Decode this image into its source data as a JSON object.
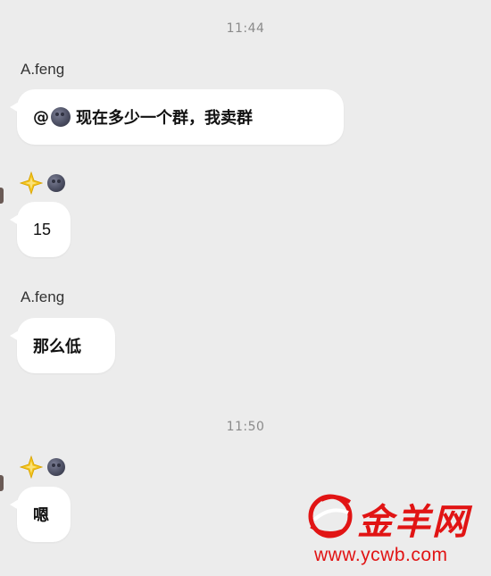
{
  "chat": {
    "time1": "11:44",
    "time2": "11:50",
    "sender_afeng": "A.feng",
    "msg1_prefix": "@",
    "msg1_text": " 现在多少一个群，我卖群",
    "msg2_text": "15",
    "msg3_text": "那么低",
    "msg4_text": "嗯"
  },
  "watermark": {
    "brand": "金羊网",
    "url": "www.ycwb.com"
  },
  "colors": {
    "background": "#ececec",
    "bubble": "#ffffff",
    "watermark_red": "#e11414",
    "sparkle_yellow": "#f2c21a"
  },
  "icons": {
    "sender_badge": "yellow-sparkle-icon",
    "sender_avatar_emoji": "new-moon-face-icon"
  }
}
